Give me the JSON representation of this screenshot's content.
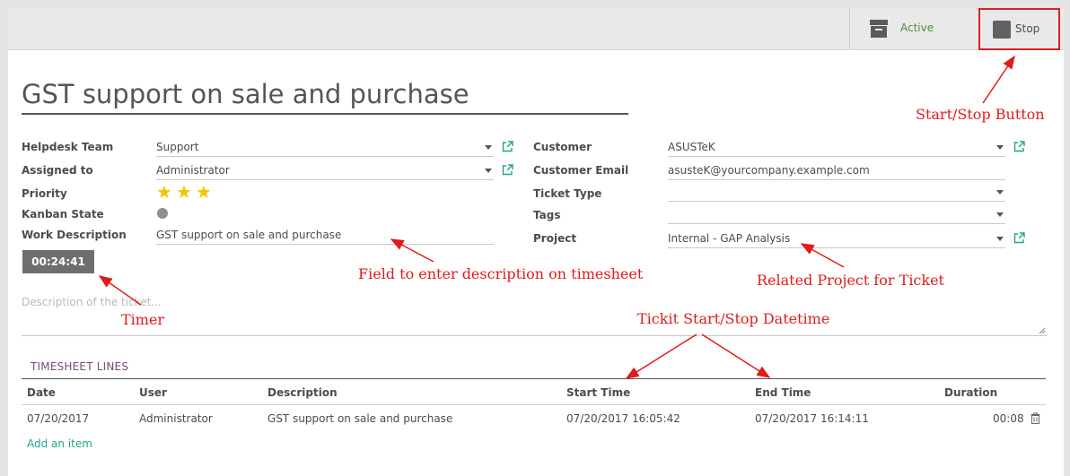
{
  "header": {
    "archive_icon": "archive-icon",
    "active_label": "Active",
    "stop_icon": "stop-square-icon",
    "stop_label": "Stop"
  },
  "ticket": {
    "title": "GST support on sale and purchase",
    "left_fields": {
      "helpdesk_team_label": "Helpdesk Team",
      "helpdesk_team_value": "Support",
      "assigned_to_label": "Assigned to",
      "assigned_to_value": "Administrator",
      "priority_label": "Priority",
      "priority_stars": 3,
      "kanban_state_label": "Kanban State",
      "work_description_label": "Work Description",
      "work_description_value": "GST support on sale and purchase"
    },
    "right_fields": {
      "customer_label": "Customer",
      "customer_value": "ASUSTeK",
      "customer_email_label": "Customer Email",
      "customer_email_value": "asusteK@yourcompany.example.com",
      "ticket_type_label": "Ticket Type",
      "ticket_type_value": "",
      "tags_label": "Tags",
      "tags_value": "",
      "project_label": "Project",
      "project_value": "Internal - GAP Analysis"
    },
    "timer": "00:24:41",
    "description_placeholder": "Description of the ticket..."
  },
  "timesheet": {
    "section_title": "TIMESHEET LINES",
    "columns": [
      "Date",
      "User",
      "Description",
      "Start Time",
      "End Time",
      "Duration"
    ],
    "rows": [
      {
        "date": "07/20/2017",
        "user": "Administrator",
        "description": "GST support on sale and purchase",
        "start_time": "07/20/2017 16:05:42",
        "end_time": "07/20/2017 16:14:11",
        "duration": "00:08"
      }
    ],
    "add_item_label": "Add an item"
  },
  "annotations": {
    "start_stop": "Start/Stop Button",
    "field_desc": "Field to enter description on timesheet",
    "timer": "Timer",
    "related_project": "Related Project for Ticket",
    "datetime": "Tickit Start/Stop Datetime"
  },
  "colors": {
    "accent_green": "#4a8f3f",
    "link_teal": "#21a38a",
    "annotation_red": "#e01b1b",
    "section_purple": "#7c4b73",
    "star_yellow": "#f5c400"
  }
}
